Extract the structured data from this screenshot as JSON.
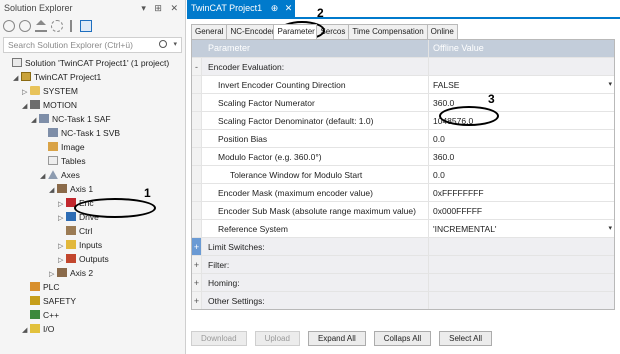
{
  "solution_explorer": {
    "title": "Solution Explorer",
    "title_controls": "▾ ⊞ ✕",
    "search_placeholder": "Search Solution Explorer (Ctrl+ü)",
    "tree": [
      {
        "label": "Solution 'TwinCAT Project1' (1 project)",
        "icon": "solution-icon",
        "level": 0,
        "twisty": ""
      },
      {
        "label": "TwinCAT Project1",
        "icon": "project-icon",
        "level": 1,
        "twisty": "◢"
      },
      {
        "label": "SYSTEM",
        "icon": "system-icon",
        "level": 2,
        "twisty": "▷"
      },
      {
        "label": "MOTION",
        "icon": "motion-icon",
        "level": 2,
        "twisty": "◢"
      },
      {
        "label": "NC-Task 1 SAF",
        "icon": "task-icon",
        "level": 3,
        "twisty": "◢"
      },
      {
        "label": "NC-Task 1 SVB",
        "icon": "task-icon",
        "level": 4,
        "twisty": ""
      },
      {
        "label": "Image",
        "icon": "image-icon",
        "level": 4,
        "twisty": ""
      },
      {
        "label": "Tables",
        "icon": "tables-icon",
        "level": 4,
        "twisty": ""
      },
      {
        "label": "Axes",
        "icon": "axes-icon",
        "level": 4,
        "twisty": "◢"
      },
      {
        "label": "Axis 1",
        "icon": "axis-icon",
        "level": 5,
        "twisty": "◢",
        "selected": true
      },
      {
        "label": "Enc",
        "icon": "encoder-icon",
        "level": 6,
        "twisty": "▷"
      },
      {
        "label": "Drive",
        "icon": "drive-icon",
        "level": 6,
        "twisty": "▷"
      },
      {
        "label": "Ctrl",
        "icon": "controller-icon",
        "level": 6,
        "twisty": ""
      },
      {
        "label": "Inputs",
        "icon": "inputs-icon",
        "level": 6,
        "twisty": "▷"
      },
      {
        "label": "Outputs",
        "icon": "outputs-icon",
        "level": 6,
        "twisty": "▷"
      },
      {
        "label": "Axis 2",
        "icon": "axis-icon",
        "level": 5,
        "twisty": "▷"
      },
      {
        "label": "PLC",
        "icon": "plc-icon",
        "level": 2,
        "twisty": ""
      },
      {
        "label": "SAFETY",
        "icon": "safety-icon",
        "level": 2,
        "twisty": ""
      },
      {
        "label": "C++",
        "icon": "cpp-icon",
        "level": 2,
        "twisty": ""
      },
      {
        "label": "I/O",
        "icon": "io-icon",
        "level": 2,
        "twisty": "◢"
      }
    ]
  },
  "document": {
    "tab_title": "TwinCAT Project1",
    "tab_pin": "⊕",
    "tab_close": "✕",
    "tabs": [
      "General",
      "NC-Encoder",
      "Parameter",
      "Sercos",
      "Time Compensation",
      "Online"
    ],
    "active_tab": "Parameter",
    "grid": {
      "col_parameter": "Parameter",
      "col_value": "Offline Value",
      "rows": [
        {
          "expander": "-",
          "name": "Encoder Evaluation:",
          "value": "",
          "section": true
        },
        {
          "expander": "",
          "name": "Invert Encoder Counting Direction",
          "value": "FALSE",
          "dropdown": true
        },
        {
          "expander": "",
          "name": "Scaling Factor Numerator",
          "value": "360.0"
        },
        {
          "expander": "",
          "name": "Scaling Factor Denominator (default: 1.0)",
          "value": "1048576.0"
        },
        {
          "expander": "",
          "name": "Position Bias",
          "value": "0.0"
        },
        {
          "expander": "",
          "name": "Modulo Factor (e.g. 360.0°)",
          "value": "360.0"
        },
        {
          "expander": "",
          "name": "Tolerance Window for Modulo Start",
          "value": "0.0",
          "indent": true
        },
        {
          "expander": "",
          "name": "Encoder Mask (maximum encoder value)",
          "value": "0xFFFFFFFF"
        },
        {
          "expander": "",
          "name": "Encoder Sub Mask (absolute range maximum value)",
          "value": "0x000FFFFF"
        },
        {
          "expander": "",
          "name": "Reference System",
          "value": "'INCREMENTAL'",
          "dropdown": true
        },
        {
          "expander": "+",
          "name": "Limit Switches:",
          "value": "",
          "section": true,
          "blue": true
        },
        {
          "expander": "+",
          "name": "Filter:",
          "value": "",
          "section": true
        },
        {
          "expander": "+",
          "name": "Homing:",
          "value": "",
          "section": true
        },
        {
          "expander": "+",
          "name": "Other Settings:",
          "value": "",
          "section": true
        }
      ]
    },
    "buttons": {
      "download": "Download",
      "upload": "Upload",
      "expand_all": "Expand All",
      "collapse_all": "Collaps All",
      "select_all": "Select All"
    }
  },
  "annotations": {
    "callout_1": "1",
    "callout_2": "2",
    "callout_3": "3"
  }
}
